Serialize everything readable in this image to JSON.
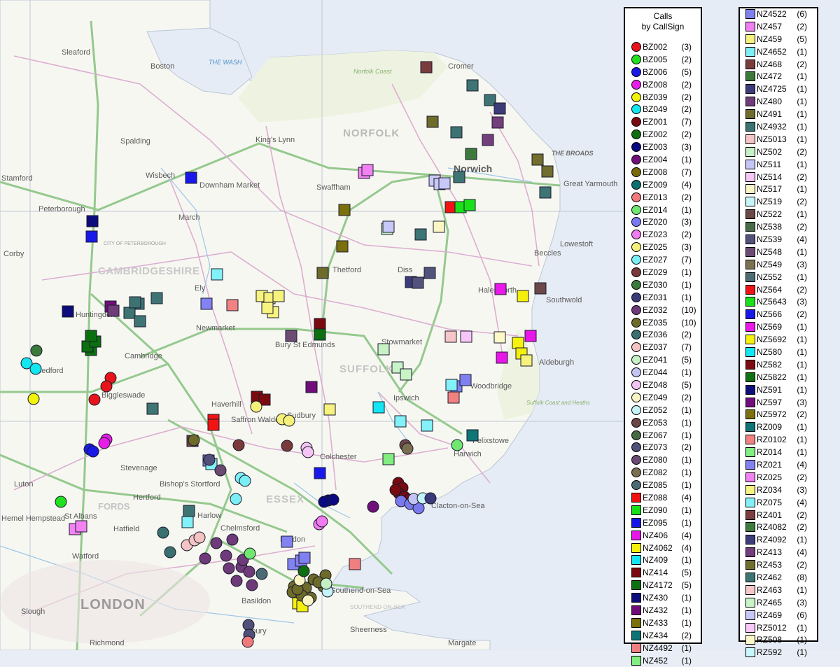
{
  "map": {
    "regions": {
      "norfolk": "NORFOLK",
      "suffolk": "SUFFOLK",
      "essex": "ESSEX",
      "cambridgeshire": "CAMBRIDGESHIRE",
      "london": "LONDON",
      "the_wash": "THE WASH",
      "the_broads": "THE BROADS",
      "norfolk_coast": "Norfolk Coast",
      "suffolk_coast": "Suffolk Coast and Heaths",
      "city_of_peterborough": "CITY OF PETERBOROUGH",
      "southend_on_sea_area": "SOUTHEND-ON-SEA",
      "stfords": "FORDS"
    },
    "places": [
      {
        "name": "Sleaford"
      },
      {
        "name": "Boston"
      },
      {
        "name": "Spalding"
      },
      {
        "name": "Stamford"
      },
      {
        "name": "Peterborough"
      },
      {
        "name": "Wisbech"
      },
      {
        "name": "Downham Market"
      },
      {
        "name": "King's Lynn"
      },
      {
        "name": "Swaffham"
      },
      {
        "name": "Cromer"
      },
      {
        "name": "Norwich"
      },
      {
        "name": "Great Yarmouth"
      },
      {
        "name": "Lowestoft"
      },
      {
        "name": "Thetford"
      },
      {
        "name": "Diss"
      },
      {
        "name": "Ely"
      },
      {
        "name": "March"
      },
      {
        "name": "Huntingdon"
      },
      {
        "name": "Cambridge"
      },
      {
        "name": "Newmarket"
      },
      {
        "name": "Bury St Edmunds"
      },
      {
        "name": "Sudbury"
      },
      {
        "name": "Ipswich"
      },
      {
        "name": "Felixstowe"
      },
      {
        "name": "Harwich"
      },
      {
        "name": "Colchester"
      },
      {
        "name": "Clacton-on-Sea"
      },
      {
        "name": "Chelmsford"
      },
      {
        "name": "Bishop's Stortford"
      },
      {
        "name": "Stevenage"
      },
      {
        "name": "Hertford"
      },
      {
        "name": "Luton"
      },
      {
        "name": "St Albans"
      },
      {
        "name": "Hatfield"
      },
      {
        "name": "Harlow"
      },
      {
        "name": "Hemel Hempstead"
      },
      {
        "name": "Watford"
      },
      {
        "name": "Basildon"
      },
      {
        "name": "Southend-on-Sea"
      },
      {
        "name": "Aldeburgh"
      },
      {
        "name": "Saffron Walden"
      },
      {
        "name": "Haverhill"
      },
      {
        "name": "Woodbridge"
      },
      {
        "name": "Beccles"
      },
      {
        "name": "Corby"
      },
      {
        "name": "Bedford"
      },
      {
        "name": "Biggleswade"
      },
      {
        "name": "Stowmarket"
      },
      {
        "name": "Halesworth"
      },
      {
        "name": "Southwold"
      },
      {
        "name": "Tilbury"
      },
      {
        "name": "Sheerness"
      },
      {
        "name": "Margate"
      },
      {
        "name": "Richmond"
      },
      {
        "name": "Slough"
      },
      {
        "name": "Maldon"
      }
    ],
    "colors": {
      "sea": "#e6ecf5",
      "land": "#f7f7f2",
      "highlight_land": "#eef3e1",
      "road_major": "#8fc58a",
      "road_minor": "#d7a6c8"
    }
  },
  "legend1": {
    "title_line1": "Calls",
    "title_line2": "by CallSign",
    "items": [
      {
        "code": "BZ002",
        "count": "(3)",
        "color": "#e8141b",
        "shape": "circle"
      },
      {
        "code": "BZ005",
        "count": "(2)",
        "color": "#20e020",
        "shape": "circle"
      },
      {
        "code": "BZ006",
        "count": "(5)",
        "color": "#1a1ae6",
        "shape": "circle"
      },
      {
        "code": "BZ008",
        "count": "(2)",
        "color": "#e81ee8",
        "shape": "circle"
      },
      {
        "code": "BZ039",
        "count": "(2)",
        "color": "#f2f20a",
        "shape": "circle"
      },
      {
        "code": "BZ049",
        "count": "(2)",
        "color": "#12e6f0",
        "shape": "circle"
      },
      {
        "code": "EZ001",
        "count": "(7)",
        "color": "#7a0a12",
        "shape": "circle"
      },
      {
        "code": "EZ002",
        "count": "(2)",
        "color": "#0e6e10",
        "shape": "circle"
      },
      {
        "code": "EZ003",
        "count": "(3)",
        "color": "#0a0a80",
        "shape": "circle"
      },
      {
        "code": "EZ004",
        "count": "(1)",
        "color": "#70107a",
        "shape": "circle"
      },
      {
        "code": "EZ008",
        "count": "(7)",
        "color": "#7a6a0c",
        "shape": "circle"
      },
      {
        "code": "EZ009",
        "count": "(4)",
        "color": "#0c7070",
        "shape": "circle"
      },
      {
        "code": "EZ013",
        "count": "(2)",
        "color": "#f07a7a",
        "shape": "circle"
      },
      {
        "code": "EZ014",
        "count": "(1)",
        "color": "#70e870",
        "shape": "circle"
      },
      {
        "code": "EZ020",
        "count": "(3)",
        "color": "#7a7af0",
        "shape": "circle"
      },
      {
        "code": "EZ023",
        "count": "(2)",
        "color": "#f07af0",
        "shape": "circle"
      },
      {
        "code": "EZ025",
        "count": "(3)",
        "color": "#f4f07a",
        "shape": "circle"
      },
      {
        "code": "EZ027",
        "count": "(7)",
        "color": "#7aeef4",
        "shape": "circle"
      },
      {
        "code": "EZ029",
        "count": "(1)",
        "color": "#7a3a3a",
        "shape": "circle"
      },
      {
        "code": "EZ030",
        "count": "(1)",
        "color": "#3a7a3a",
        "shape": "circle"
      },
      {
        "code": "EZ031",
        "count": "(1)",
        "color": "#3a3a7a",
        "shape": "circle"
      },
      {
        "code": "EZ032",
        "count": "(10)",
        "color": "#6e3a7a",
        "shape": "circle"
      },
      {
        "code": "EZ035",
        "count": "(10)",
        "color": "#6e6a2a",
        "shape": "circle"
      },
      {
        "code": "EZ036",
        "count": "(2)",
        "color": "#3a7070",
        "shape": "circle"
      },
      {
        "code": "EZ037",
        "count": "(7)",
        "color": "#f4c4c4",
        "shape": "circle"
      },
      {
        "code": "EZ041",
        "count": "(5)",
        "color": "#c4f0c4",
        "shape": "circle"
      },
      {
        "code": "EZ044",
        "count": "(1)",
        "color": "#c4c4f4",
        "shape": "circle"
      },
      {
        "code": "EZ048",
        "count": "(5)",
        "color": "#f4c4f4",
        "shape": "circle"
      },
      {
        "code": "EZ049",
        "count": "(2)",
        "color": "#f8f4c4",
        "shape": "circle"
      },
      {
        "code": "EZ052",
        "count": "(1)",
        "color": "#c4f4f8",
        "shape": "circle"
      },
      {
        "code": "EZ053",
        "count": "(1)",
        "color": "#6a4646",
        "shape": "circle"
      },
      {
        "code": "EZ067",
        "count": "(1)",
        "color": "#466a46",
        "shape": "circle"
      },
      {
        "code": "EZ073",
        "count": "(2)",
        "color": "#50507a",
        "shape": "circle"
      },
      {
        "code": "EZ080",
        "count": "(1)",
        "color": "#6a4a70",
        "shape": "circle"
      },
      {
        "code": "EZ082",
        "count": "(1)",
        "color": "#7a7050",
        "shape": "circle"
      },
      {
        "code": "EZ085",
        "count": "(1)",
        "color": "#4a6a74",
        "shape": "circle"
      },
      {
        "code": "EZ088",
        "count": "(4)",
        "color": "#f01212",
        "shape": "square"
      },
      {
        "code": "EZ090",
        "count": "(1)",
        "color": "#18e018",
        "shape": "square"
      },
      {
        "code": "EZ095",
        "count": "(1)",
        "color": "#1616e8",
        "shape": "square"
      },
      {
        "code": "NZ406",
        "count": "(4)",
        "color": "#e816e8",
        "shape": "square"
      },
      {
        "code": "NZ4062",
        "count": "(4)",
        "color": "#f4f00c",
        "shape": "square"
      },
      {
        "code": "NZ409",
        "count": "(1)",
        "color": "#12e6f4",
        "shape": "square"
      },
      {
        "code": "NZ414",
        "count": "(5)",
        "color": "#7a0a10",
        "shape": "square"
      },
      {
        "code": "NZ4172",
        "count": "(5)",
        "color": "#0c7010",
        "shape": "square"
      },
      {
        "code": "NZ430",
        "count": "(1)",
        "color": "#0c0c7c",
        "shape": "square"
      },
      {
        "code": "NZ432",
        "count": "(1)",
        "color": "#700c7a",
        "shape": "square"
      },
      {
        "code": "NZ433",
        "count": "(1)",
        "color": "#7a700c",
        "shape": "square"
      },
      {
        "code": "NZ434",
        "count": "(2)",
        "color": "#0c7474",
        "shape": "square"
      },
      {
        "code": "NZ4492",
        "count": "(1)",
        "color": "#f08080",
        "shape": "square"
      },
      {
        "code": "NZ452",
        "count": "(1)",
        "color": "#80ee80",
        "shape": "square"
      }
    ]
  },
  "legend2": {
    "items": [
      {
        "code": "NZ4522",
        "count": "(6)",
        "color": "#8080f0",
        "shape": "square"
      },
      {
        "code": "NZ457",
        "count": "(2)",
        "color": "#f080f0",
        "shape": "square"
      },
      {
        "code": "NZ459",
        "count": "(5)",
        "color": "#f6f27e",
        "shape": "square"
      },
      {
        "code": "NZ4652",
        "count": "(1)",
        "color": "#80f0f6",
        "shape": "square"
      },
      {
        "code": "NZ468",
        "count": "(2)",
        "color": "#7a3c3c",
        "shape": "square"
      },
      {
        "code": "NZ472",
        "count": "(1)",
        "color": "#3c7a3c",
        "shape": "square"
      },
      {
        "code": "NZ4725",
        "count": "(1)",
        "color": "#3c3c7a",
        "shape": "square"
      },
      {
        "code": "NZ480",
        "count": "(1)",
        "color": "#703c7a",
        "shape": "square"
      },
      {
        "code": "NZ491",
        "count": "(1)",
        "color": "#706c2c",
        "shape": "square"
      },
      {
        "code": "NZ4932",
        "count": "(1)",
        "color": "#3c7272",
        "shape": "square"
      },
      {
        "code": "NZ5013",
        "count": "(1)",
        "color": "#f6c6c6",
        "shape": "square"
      },
      {
        "code": "NZ502",
        "count": "(2)",
        "color": "#c6f2c6",
        "shape": "square"
      },
      {
        "code": "NZ511",
        "count": "(1)",
        "color": "#c6c6f6",
        "shape": "square"
      },
      {
        "code": "NZ514",
        "count": "(2)",
        "color": "#f6c6f6",
        "shape": "square"
      },
      {
        "code": "NZ517",
        "count": "(1)",
        "color": "#faf6c6",
        "shape": "square"
      },
      {
        "code": "NZ519",
        "count": "(2)",
        "color": "#c6f6fa",
        "shape": "square"
      },
      {
        "code": "NZ522",
        "count": "(1)",
        "color": "#6c4848",
        "shape": "square"
      },
      {
        "code": "NZ538",
        "count": "(2)",
        "color": "#486c48",
        "shape": "square"
      },
      {
        "code": "NZ539",
        "count": "(4)",
        "color": "#52527c",
        "shape": "square"
      },
      {
        "code": "NZ548",
        "count": "(1)",
        "color": "#6c4c72",
        "shape": "square"
      },
      {
        "code": "NZ549",
        "count": "(3)",
        "color": "#7c7252",
        "shape": "square"
      },
      {
        "code": "NZ552",
        "count": "(1)",
        "color": "#4c6c76",
        "shape": "square"
      },
      {
        "code": "NZ564",
        "count": "(2)",
        "color": "#f21414",
        "shape": "square"
      },
      {
        "code": "NZ5643",
        "count": "(3)",
        "color": "#1ae21a",
        "shape": "square"
      },
      {
        "code": "NZ566",
        "count": "(2)",
        "color": "#1818ea",
        "shape": "square"
      },
      {
        "code": "NZ569",
        "count": "(1)",
        "color": "#ea18ea",
        "shape": "square"
      },
      {
        "code": "NZ5692",
        "count": "(1)",
        "color": "#f6f20e",
        "shape": "square"
      },
      {
        "code": "NZ580",
        "count": "(1)",
        "color": "#14e8f6",
        "shape": "square"
      },
      {
        "code": "NZ582",
        "count": "(1)",
        "color": "#7c0c12",
        "shape": "square"
      },
      {
        "code": "NZ5822",
        "count": "(1)",
        "color": "#0e7212",
        "shape": "square"
      },
      {
        "code": "NZ591",
        "count": "(1)",
        "color": "#0e0e7e",
        "shape": "square"
      },
      {
        "code": "NZ597",
        "count": "(3)",
        "color": "#720e7c",
        "shape": "square"
      },
      {
        "code": "NZ5972",
        "count": "(2)",
        "color": "#7c720e",
        "shape": "square"
      },
      {
        "code": "RZ009",
        "count": "(1)",
        "color": "#0e7676",
        "shape": "square"
      },
      {
        "code": "RZ0102",
        "count": "(1)",
        "color": "#f28282",
        "shape": "square"
      },
      {
        "code": "RZ014",
        "count": "(1)",
        "color": "#82f082",
        "shape": "square"
      },
      {
        "code": "RZ021",
        "count": "(4)",
        "color": "#8282f2",
        "shape": "square"
      },
      {
        "code": "RZ025",
        "count": "(2)",
        "color": "#f282f2",
        "shape": "square"
      },
      {
        "code": "RZ034",
        "count": "(3)",
        "color": "#f8f480",
        "shape": "square"
      },
      {
        "code": "RZ075",
        "count": "(4)",
        "color": "#82f2f8",
        "shape": "square"
      },
      {
        "code": "RZ401",
        "count": "(2)",
        "color": "#7c3e3e",
        "shape": "square"
      },
      {
        "code": "RZ4082",
        "count": "(2)",
        "color": "#3e7c3e",
        "shape": "square"
      },
      {
        "code": "RZ4092",
        "count": "(1)",
        "color": "#3e3e7c",
        "shape": "square"
      },
      {
        "code": "RZ413",
        "count": "(4)",
        "color": "#723e7c",
        "shape": "square"
      },
      {
        "code": "RZ453",
        "count": "(2)",
        "color": "#726e2e",
        "shape": "square"
      },
      {
        "code": "RZ462",
        "count": "(8)",
        "color": "#3e7474",
        "shape": "square"
      },
      {
        "code": "RZ463",
        "count": "(1)",
        "color": "#f8c8c8",
        "shape": "square"
      },
      {
        "code": "RZ465",
        "count": "(3)",
        "color": "#c8f4c8",
        "shape": "square"
      },
      {
        "code": "RZ469",
        "count": "(6)",
        "color": "#c8c8f8",
        "shape": "square"
      },
      {
        "code": "RZ5012",
        "count": "(1)",
        "color": "#f8c8f8",
        "shape": "square"
      },
      {
        "code": "RZ508",
        "count": "(1)",
        "color": "#fcf8c8",
        "shape": "square"
      },
      {
        "code": "RZ592",
        "count": "(1)",
        "color": "#c8f8fc",
        "shape": "square"
      }
    ]
  }
}
